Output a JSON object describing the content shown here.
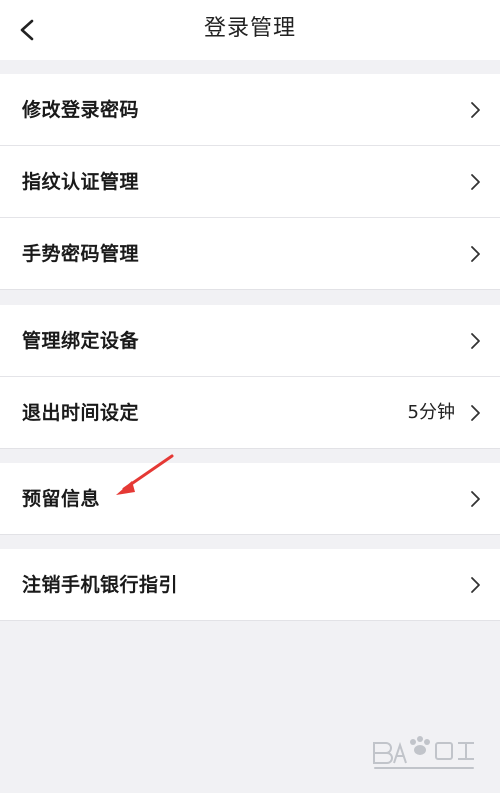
{
  "header": {
    "title": "登录管理",
    "back_icon": "chevron-left-icon"
  },
  "groups": [
    {
      "items": [
        {
          "label": "修改登录密码"
        },
        {
          "label": "指纹认证管理"
        },
        {
          "label": "手势密码管理"
        }
      ]
    },
    {
      "items": [
        {
          "label": "管理绑定设备"
        },
        {
          "label": "退出时间设定",
          "value": "5分钟"
        }
      ]
    },
    {
      "items": [
        {
          "label": "预留信息"
        }
      ]
    },
    {
      "items": [
        {
          "label": "注销手机银行指引"
        }
      ]
    }
  ],
  "colors": {
    "background": "#f1f1f4",
    "row_background": "#ffffff",
    "annotation_arrow": "#e53935"
  }
}
